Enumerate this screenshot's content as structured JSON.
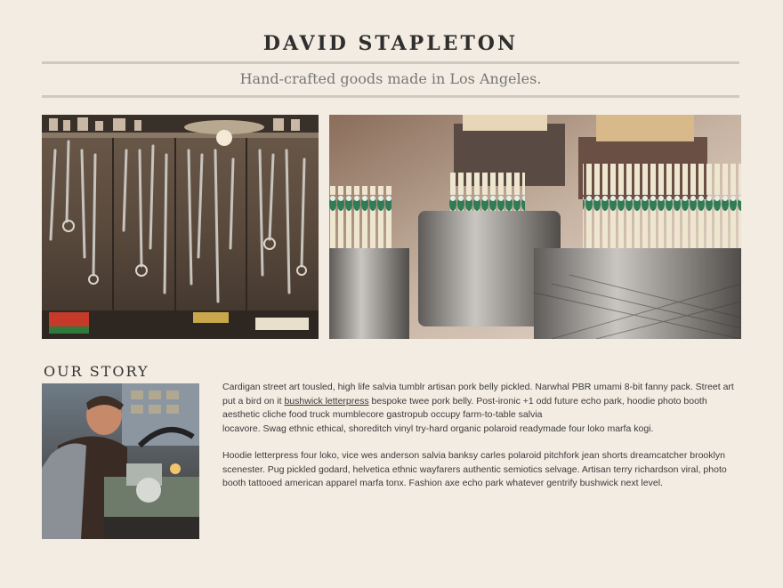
{
  "header": {
    "title": "DAVID STAPLETON",
    "tagline": "Hand-crafted goods made in Los Angeles."
  },
  "hero": {
    "left_image": "tools-pegboard-image",
    "right_image": "matchsticks-jars-image"
  },
  "story": {
    "heading": "OUR STORY",
    "photo": "craftsman-at-lathe-image",
    "p1_before_link": "Cardigan street art tousled, high life salvia tumblr artisan pork belly pickled. Narwhal PBR umami 8-bit fanny pack. Street art put a bird on it ",
    "p1_link": "bushwick letterpress",
    "p1_after_link": " bespoke twee pork belly. Post-ironic +1 odd future echo park, hoodie photo booth aesthetic cliche food truck mumblecore gastropub occupy farm-to-table salvia",
    "p1_line2": "locavore. Swag ethnic ethical, shoreditch vinyl try-hard organic polaroid readymade four loko marfa kogi.",
    "p2": "Hoodie letterpress four loko, vice wes anderson salvia banksy carles polaroid pitchfork jean shorts dreamcatcher brooklyn scenester. Pug pickled godard, helvetica ethnic wayfarers authentic semiotics selvage. Artisan terry richardson viral, photo booth tattooed american apparel marfa tonx. Fashion axe echo park whatever gentrify bushwick next level."
  },
  "colors": {
    "background": "#f3ece2",
    "rule": "#cfc9c0",
    "title": "#2f2f2f",
    "tagline": "#777777"
  }
}
